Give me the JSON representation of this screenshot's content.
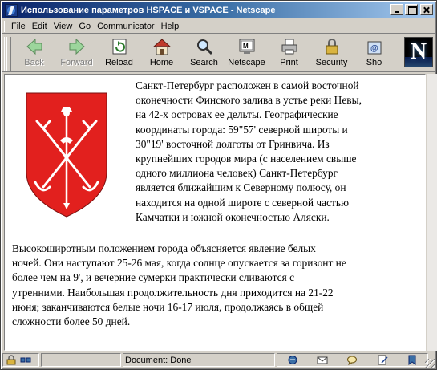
{
  "window": {
    "title": "Использование параметров HSPACE и VSPACE - Netscape",
    "app_icon": "netscape-icon",
    "controls": [
      "minimize-icon",
      "maximize-icon",
      "close-icon"
    ]
  },
  "menu": {
    "items": [
      {
        "label": "File"
      },
      {
        "label": "Edit"
      },
      {
        "label": "View"
      },
      {
        "label": "Go"
      },
      {
        "label": "Communicator"
      },
      {
        "label": "Help"
      }
    ]
  },
  "toolbar": {
    "buttons": [
      {
        "label": "Back",
        "icon": "back-arrow-icon",
        "enabled": false
      },
      {
        "label": "Forward",
        "icon": "forward-arrow-icon",
        "enabled": false
      },
      {
        "label": "Reload",
        "icon": "reload-icon",
        "enabled": true
      },
      {
        "label": "Home",
        "icon": "home-icon",
        "enabled": true
      },
      {
        "label": "Search",
        "icon": "search-icon",
        "enabled": true
      },
      {
        "label": "Netscape",
        "icon": "netscape-my-icon",
        "enabled": true
      },
      {
        "label": "Print",
        "icon": "printer-icon",
        "enabled": true
      },
      {
        "label": "Security",
        "icon": "padlock-icon",
        "enabled": true
      },
      {
        "label": "Sho",
        "icon": "shop-icon",
        "enabled": true
      }
    ],
    "logo_letter": "N"
  },
  "content": {
    "image": {
      "icon": "saint-petersburg-coat-of-arms-icon",
      "colors": {
        "shield": "#e2201e",
        "emblem": "#ffffff"
      }
    },
    "paragraph1_lines": [
      "Санкт-Петербург расположен в самой восточной",
      "оконечности Финского залива в устье реки Невы,",
      "на 42-х островах ее дельты. Географические",
      "координаты города: 59\"57' северной широты и",
      "30\"19' восточной долготы от Гринвича. Из",
      "крупнейших городов мира (с населением свыше",
      "одного миллиона человек) Санкт-Петербург",
      "является ближайшим к Северному полюсу, он",
      "находится на одной широте с северной частью",
      "Камчатки и южной оконечностью Аляски."
    ],
    "paragraph2_lines": [
      "Высокоширотным положением города объясняется явление белых",
      "ночей. Они наступают 25-26 мая, когда солнце опускается за горизонт не",
      "более чем на 9', и вечерние сумерки практически сливаются с",
      "утренними. Наибольшая продолжительность дня приходится на 21-22",
      "июня; заканчиваются белые ночи 16-17 июля, продолжаясь в общей",
      "сложности более 50 дней."
    ]
  },
  "statusbar": {
    "status_text": "Document: Done",
    "left_icons": [
      "security-lock-icon",
      "connection-icon"
    ],
    "tray_icons": [
      "navigator-icon",
      "mail-icon",
      "discussion-icon",
      "composer-icon",
      "bookmark-icon"
    ]
  }
}
